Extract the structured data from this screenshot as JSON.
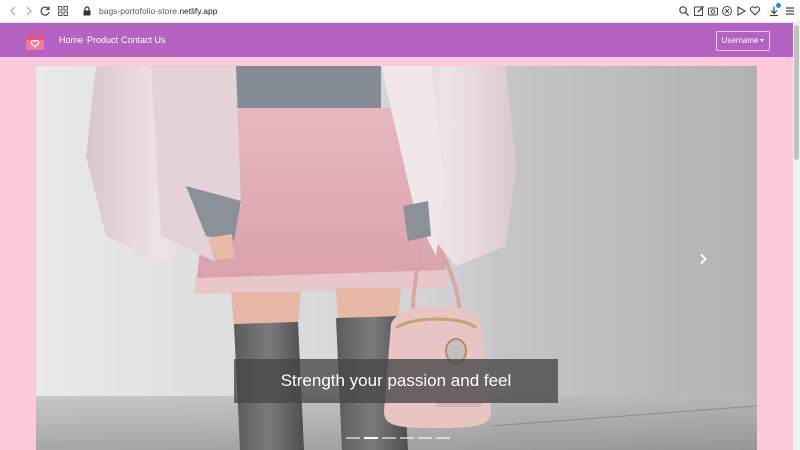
{
  "browser": {
    "url_host_prefix": "bags-portofolio-store.",
    "url_host_domain": "netlify.app"
  },
  "navbar": {
    "brand_icon": "shopping-bag-heart-icon",
    "links": [
      "Home",
      "Product",
      "Contact Us"
    ],
    "user_menu_label": "Username"
  },
  "carousel": {
    "caption": "Strength your passion and feel",
    "slide_count": 6,
    "active_index": 1,
    "next_icon": "chevron-right-icon"
  },
  "colors": {
    "navbar": "#b463c2",
    "page_background": "#fdc9dc"
  }
}
